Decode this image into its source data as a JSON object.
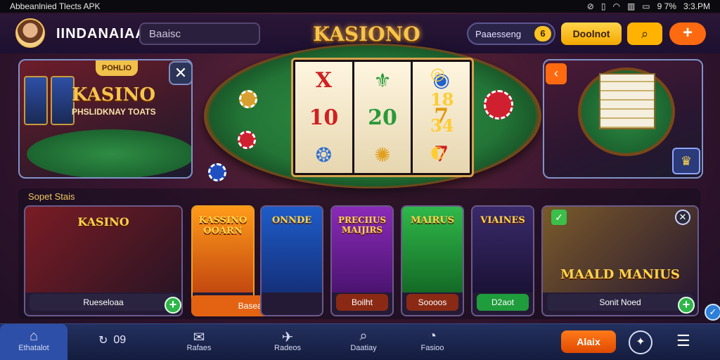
{
  "statusbar": {
    "left_text": "Abbeanlnied Tlects APK",
    "battery": "9 7%",
    "time": "3:3.PM"
  },
  "header": {
    "username": "IINDANAIAA",
    "search_value": "Baaisc",
    "logo": "KASIONO",
    "coins_label": "Paaesseng",
    "coins_badge": "6",
    "deposit_label": "Doolnot",
    "search_icon": "search-icon",
    "add_icon": "plus-icon"
  },
  "hero": {
    "left_badge": "POHLIO",
    "left_title": "KASINO",
    "left_subtitle": "PHSLIDKNAY TOATS",
    "reel_symbols": [
      [
        "X",
        "10",
        "❂"
      ],
      [
        "⚜",
        "20",
        "✺"
      ],
      [
        "◉",
        "7",
        "7"
      ]
    ],
    "side_symbols": [
      "◎",
      "18",
      "34",
      "◐"
    ]
  },
  "section": {
    "title": "Sopet Stais"
  },
  "cards": [
    {
      "title": "KASINO",
      "label": "Rueseloaa",
      "label_color": "#2a2440",
      "art_color_a": "#7a1c24",
      "art_color_b": "#2a1424"
    },
    {
      "title": "KASSINO OOARN",
      "label": "Baseadut",
      "label_color": "#e46312",
      "art_color_a": "#ff9a1a",
      "art_color_b": "#c34810"
    },
    {
      "title": "ONNDE",
      "label": "",
      "label_color": "#2a2440",
      "art_color_a": "#1e5cc8",
      "art_color_b": "#15307a"
    },
    {
      "title": "PRECIIUS MAIJIRS",
      "label": "Boilht",
      "label_color": "#8a2a14",
      "art_color_a": "#8a2ab8",
      "art_color_b": "#4a1470"
    },
    {
      "title": "MAIRUS",
      "label": "Soooos",
      "label_color": "#8a2a14",
      "art_color_a": "#2fb84a",
      "art_color_b": "#146a26"
    },
    {
      "title": "VIAINES",
      "label": "D2aot",
      "label_color": "#1f9c3c",
      "art_color_a": "#3a2a6a",
      "art_color_b": "#1a1236"
    },
    {
      "title": "MAALD MANIUS",
      "label": "Sonit Noed",
      "label_color": "#2a2440",
      "art_color_a": "#7a5a2a",
      "art_color_b": "#2a1a30"
    }
  ],
  "bottomnav": {
    "items": [
      {
        "label": "Ethatalot",
        "icon": "home-icon"
      },
      {
        "label": "Rafaes",
        "icon": "mail-icon"
      },
      {
        "label": "Radeos",
        "icon": "plane-icon"
      },
      {
        "label": "Daatiay",
        "icon": "search-icon"
      },
      {
        "label": "Fasioo",
        "icon": "chart-icon"
      }
    ],
    "stat_value": "09",
    "alert_label": "Alaix"
  }
}
